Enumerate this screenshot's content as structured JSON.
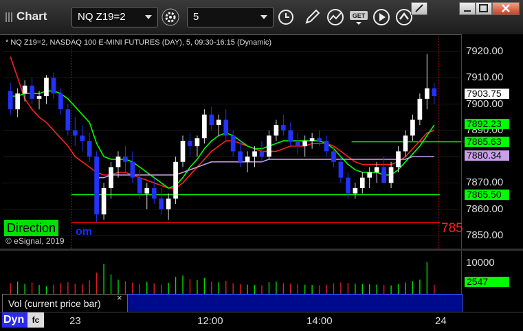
{
  "window": {
    "title": "Chart",
    "symbol": "NQ Z19=2",
    "interval": "5",
    "controls": [
      "minimize",
      "restore",
      "close"
    ]
  },
  "toolbar_icons": [
    "settings-icon",
    "clock-icon",
    "pencil-icon",
    "chart-study-icon",
    "get-data-icon",
    "play-icon",
    "up-arrow-icon"
  ],
  "chart": {
    "info": "* NQ Z19=2, NASDAQ 100 E-MINI FUTURES (DAY), 5, 09:30-16:15 (Dynamic)",
    "copyright": "© eSignal, 2019",
    "direction_label": "Direction",
    "direction_tail": "om",
    "right_red_text": "785",
    "price_ticks": [
      "7920.00",
      "7910.00",
      "7900.00",
      "7890.00",
      "7880.00",
      "7870.00",
      "7860.00",
      "7850.00"
    ],
    "price_tags": [
      {
        "text": "7903.75",
        "color": "#ffffff"
      },
      {
        "text": "7892.23",
        "color": "#00ff00"
      },
      {
        "text": "7885.63",
        "color": "#00ff00"
      },
      {
        "text": "7880.34",
        "color": "#c9a0e8"
      },
      {
        "text": "7865.50",
        "color": "#00ff00"
      }
    ],
    "time_ticks": [
      "23",
      "12:00",
      "14:00",
      "24"
    ]
  },
  "volume": {
    "label": "Vol (current price bar)",
    "close": "×",
    "ticks": [
      "10000"
    ],
    "last": "2547",
    "ylim": [
      0,
      12000
    ]
  },
  "footer": {
    "dyn": "Dyn",
    "fc": "fc"
  },
  "chart_data": {
    "type": "line",
    "y_range": [
      7845,
      7926
    ],
    "candles": [
      [
        7905,
        7908,
        7896,
        7898
      ],
      [
        7898,
        7906,
        7895,
        7904
      ],
      [
        7904,
        7909,
        7901,
        7907
      ],
      [
        7907,
        7910,
        7900,
        7902
      ],
      [
        7902,
        7905,
        7898,
        7903
      ],
      [
        7903,
        7911,
        7900,
        7910
      ],
      [
        7910,
        7912,
        7902,
        7904
      ],
      [
        7904,
        7906,
        7896,
        7898
      ],
      [
        7898,
        7900,
        7888,
        7890
      ],
      [
        7890,
        7895,
        7884,
        7888
      ],
      [
        7888,
        7892,
        7882,
        7886
      ],
      [
        7886,
        7889,
        7878,
        7880
      ],
      [
        7880,
        7882,
        7855,
        7858
      ],
      [
        7858,
        7870,
        7856,
        7868
      ],
      [
        7868,
        7878,
        7864,
        7876
      ],
      [
        7876,
        7882,
        7872,
        7880
      ],
      [
        7880,
        7884,
        7874,
        7878
      ],
      [
        7878,
        7882,
        7870,
        7872
      ],
      [
        7872,
        7875,
        7864,
        7866
      ],
      [
        7866,
        7870,
        7860,
        7868
      ],
      [
        7868,
        7872,
        7862,
        7864
      ],
      [
        7864,
        7868,
        7858,
        7860
      ],
      [
        7860,
        7866,
        7856,
        7864
      ],
      [
        7864,
        7880,
        7862,
        7878
      ],
      [
        7878,
        7888,
        7876,
        7886
      ],
      [
        7886,
        7889,
        7880,
        7884
      ],
      [
        7884,
        7888,
        7880,
        7887
      ],
      [
        7887,
        7898,
        7885,
        7896
      ],
      [
        7896,
        7899,
        7890,
        7892
      ],
      [
        7892,
        7896,
        7888,
        7894
      ],
      [
        7894,
        7898,
        7886,
        7888
      ],
      [
        7888,
        7890,
        7880,
        7882
      ],
      [
        7882,
        7886,
        7876,
        7878
      ],
      [
        7878,
        7882,
        7874,
        7880
      ],
      [
        7880,
        7884,
        7876,
        7882
      ],
      [
        7882,
        7886,
        7878,
        7880
      ],
      [
        7880,
        7890,
        7879,
        7888
      ],
      [
        7888,
        7894,
        7886,
        7892
      ],
      [
        7892,
        7896,
        7888,
        7890
      ],
      [
        7890,
        7893,
        7884,
        7886
      ],
      [
        7886,
        7889,
        7881,
        7884
      ],
      [
        7884,
        7888,
        7880,
        7886
      ],
      [
        7886,
        7889,
        7883,
        7887
      ],
      [
        7887,
        7890,
        7884,
        7886
      ],
      [
        7886,
        7888,
        7880,
        7882
      ],
      [
        7882,
        7884,
        7876,
        7878
      ],
      [
        7878,
        7880,
        7870,
        7872
      ],
      [
        7872,
        7874,
        7864,
        7866
      ],
      [
        7866,
        7870,
        7864,
        7868
      ],
      [
        7868,
        7874,
        7866,
        7872
      ],
      [
        7872,
        7876,
        7868,
        7874
      ],
      [
        7874,
        7878,
        7870,
        7876
      ],
      [
        7876,
        7880,
        7872,
        7870
      ],
      [
        7870,
        7878,
        7868,
        7876
      ],
      [
        7876,
        7884,
        7874,
        7882
      ],
      [
        7882,
        7890,
        7880,
        7888
      ],
      [
        7888,
        7896,
        7886,
        7894
      ],
      [
        7894,
        7904,
        7892,
        7902
      ],
      [
        7902,
        7919,
        7898,
        7906
      ],
      [
        7906,
        7908,
        7900,
        7903
      ]
    ],
    "series": [
      {
        "color": "#ff2020",
        "values": [
          7918,
          7910,
          7902,
          7898,
          7895,
          7893,
          7890,
          7887,
          7884,
          7880,
          7878,
          7876,
          7874,
          7873,
          7873,
          7874,
          7874,
          7873,
          7872,
          7871,
          7870,
          7869,
          7868,
          7868,
          7870,
          7873,
          7876,
          7879,
          7882,
          7884,
          7886,
          7886,
          7885,
          7884,
          7883,
          7882,
          7882,
          7882,
          7883,
          7884,
          7884,
          7884,
          7885,
          7885,
          7885,
          7884,
          7882,
          7880,
          7878,
          7877,
          7877,
          7877,
          7877,
          7877,
          7878,
          7880,
          7883,
          7886,
          7889,
          7890
        ]
      },
      {
        "color": "#00ff00",
        "values": [
          7903,
          7903,
          7904,
          7904,
          7904,
          7905,
          7905,
          7904,
          7902,
          7899,
          7896,
          7893,
          7885,
          7880,
          7879,
          7879,
          7879,
          7878,
          7876,
          7874,
          7872,
          7870,
          7868,
          7869,
          7872,
          7876,
          7879,
          7883,
          7886,
          7888,
          7889,
          7888,
          7886,
          7884,
          7883,
          7883,
          7884,
          7885,
          7886,
          7886,
          7886,
          7886,
          7886,
          7886,
          7885,
          7883,
          7880,
          7877,
          7875,
          7874,
          7874,
          7874,
          7873,
          7873,
          7875,
          7878,
          7881,
          7884,
          7888,
          7892
        ]
      },
      {
        "color": "#c9a0e8",
        "values": [
          null,
          null,
          null,
          null,
          null,
          null,
          null,
          null,
          null,
          null,
          null,
          null,
          7872,
          7872,
          7873,
          7873,
          7873,
          7873,
          7873,
          7873,
          7873,
          7873,
          7873,
          7873,
          7874,
          7875,
          7876,
          7877,
          7878,
          7878,
          7878,
          7878,
          7878,
          7878,
          7878,
          7878,
          7879,
          7879,
          7879,
          7879,
          7879,
          7879,
          7879,
          7879,
          7879,
          7879,
          7879,
          7879,
          7879,
          7879,
          7879,
          7879,
          7879,
          7879,
          7879,
          7879,
          7880,
          7880,
          7880,
          7880
        ]
      }
    ],
    "levels": [
      {
        "value": 7865.5,
        "color": "#00ff00"
      },
      {
        "value": 7855,
        "color": "#ff0000"
      },
      {
        "value": 7885.63,
        "color": "#00ff00"
      }
    ],
    "volume": [
      3000,
      3500,
      2800,
      3200,
      2500,
      2200,
      2600,
      3000,
      3300,
      2900,
      2700,
      3800,
      6000,
      8500,
      5500,
      4000,
      3600,
      3200,
      2800,
      3400,
      3000,
      2600,
      3100,
      4800,
      5200,
      4200,
      3900,
      4500,
      3500,
      3300,
      3700,
      3000,
      2800,
      2600,
      2500,
      2400,
      3300,
      3500,
      3000,
      2900,
      2700,
      2600,
      2500,
      2400,
      2600,
      3000,
      3200,
      3100,
      2900,
      2800,
      2700,
      2600,
      2500,
      2400,
      2800,
      3200,
      3600,
      4000,
      9000,
      2547
    ]
  }
}
